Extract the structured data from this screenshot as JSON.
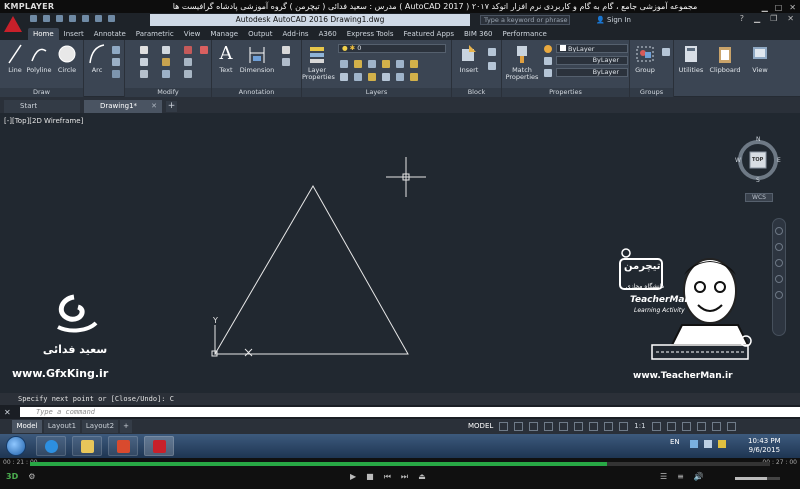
{
  "player": {
    "name": "KMPLAYER",
    "window_title": "مجموعه آموزشی جامع ، گام به گام و کاربردی نرم افزار  اتوکد ۲۰۱۷ ( AutoCAD 2017 )  مدرس : سعید فدائی ( تیچرمن ) گروه آموزشی پادشاه گرافیست ها",
    "time_current": "00 : 21 : 00",
    "time_total": "00 : 27 : 00",
    "progress": 0.78,
    "volume": 0.7
  },
  "app": {
    "title": "Autodesk AutoCAD 2016    Drawing1.dwg",
    "search_placeholder": "Type a keyword or phrase",
    "sign_in": "Sign In"
  },
  "ribbon": {
    "tabs": [
      "Home",
      "Insert",
      "Annotate",
      "Parametric",
      "View",
      "Manage",
      "Output",
      "Add-ins",
      "A360",
      "Express Tools",
      "Featured Apps",
      "BIM 360",
      "Performance"
    ],
    "active_tab": "Home",
    "panels": {
      "draw": {
        "label": "Draw",
        "tools": [
          "Line",
          "Polyline",
          "Circle",
          "Arc"
        ]
      },
      "modify": {
        "label": "Modify"
      },
      "annotation": {
        "label": "Annotation",
        "tools": [
          "Text",
          "Dimension"
        ]
      },
      "layers": {
        "label": "Layers",
        "tool": "Layer Properties",
        "current_layer": "0"
      },
      "block": {
        "label": "Block",
        "tool": "Insert"
      },
      "properties": {
        "label": "Properties",
        "tool": "Match Properties",
        "color": "ByLayer",
        "linetype": "ByLayer",
        "lineweight": "ByLayer"
      },
      "groups": {
        "label": "Groups",
        "tool": "Group"
      },
      "utilities": {
        "tool": "Utilities"
      },
      "clipboard": {
        "tool": "Clipboard"
      },
      "view": {
        "tool": "View"
      }
    }
  },
  "file_tabs": [
    {
      "label": "Start"
    },
    {
      "label": "Drawing1*"
    }
  ],
  "viewport": {
    "label": "[-][Top][2D Wireframe]",
    "viewcube": {
      "top": "TOP",
      "n": "N",
      "s": "S",
      "e": "E",
      "w": "W"
    },
    "wcs": "WCS",
    "ucs_y": "Y"
  },
  "watermark": {
    "name_fa": "سعید فدائی",
    "site_left": "www.GfxKing.ir",
    "brand_fa": "تیچرمن",
    "brand_sub_fa": "دانشگاه مجازی",
    "brand_en": "TeacherMan",
    "brand_tagline": "Learning Activity",
    "site_right": "www.TeacherMan.ir"
  },
  "command": {
    "history": "Specify next point or [Close/Undo]: C",
    "placeholder": "Type a command"
  },
  "layout_tabs": [
    "Model",
    "Layout1",
    "Layout2"
  ],
  "status": {
    "model": "MODEL",
    "scale": "1:1"
  },
  "taskbar": {
    "lang": "EN",
    "time": "10:43 PM",
    "date": "9/6/2015"
  },
  "colors": {
    "autocad_red": "#c8202a",
    "seek_green": "#28a745",
    "canvas": "#212830"
  }
}
